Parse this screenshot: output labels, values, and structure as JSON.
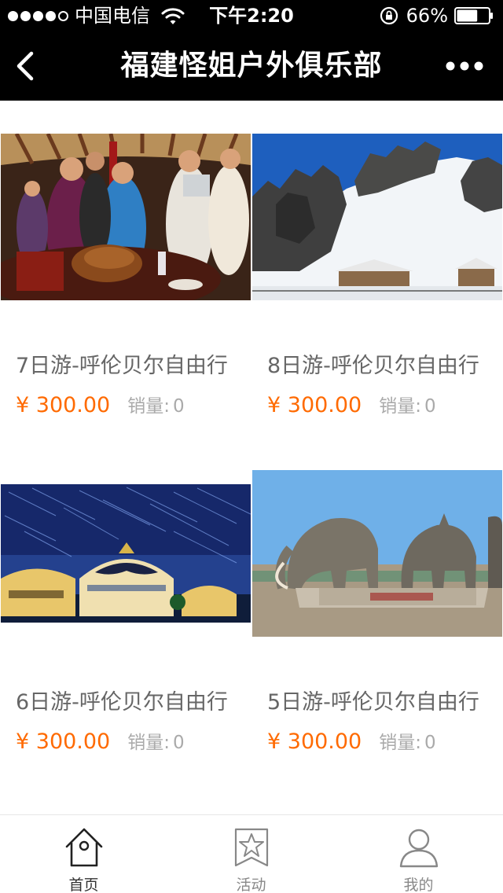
{
  "status_bar": {
    "carrier": "中国电信",
    "time": "下午2:20",
    "battery": "66%",
    "battery_level": 0.66
  },
  "nav": {
    "title": "福建怪姐户外俱乐部",
    "back_icon": "chevron-left-icon",
    "more_icon": "more-dots-icon"
  },
  "products": [
    {
      "title": "7日游-呼伦贝尔自由行",
      "price": "¥ 300.00",
      "sales_label": "销量:",
      "sales_value": "0"
    },
    {
      "title": "8日游-呼伦贝尔自由行",
      "price": "¥ 300.00",
      "sales_label": "销量:",
      "sales_value": "0"
    },
    {
      "title": "6日游-呼伦贝尔自由行",
      "price": "¥ 300.00",
      "sales_label": "销量:",
      "sales_value": "0"
    },
    {
      "title": "5日游-呼伦贝尔自由行",
      "price": "¥ 300.00",
      "sales_label": "销量:",
      "sales_value": "0"
    }
  ],
  "tabs": [
    {
      "label": "首页",
      "icon": "home-icon",
      "active": true
    },
    {
      "label": "活动",
      "icon": "star-flag-icon",
      "active": false
    },
    {
      "label": "我的",
      "icon": "user-icon",
      "active": false
    }
  ],
  "colors": {
    "price": "#ff6a00",
    "bar_background": "#000000"
  }
}
